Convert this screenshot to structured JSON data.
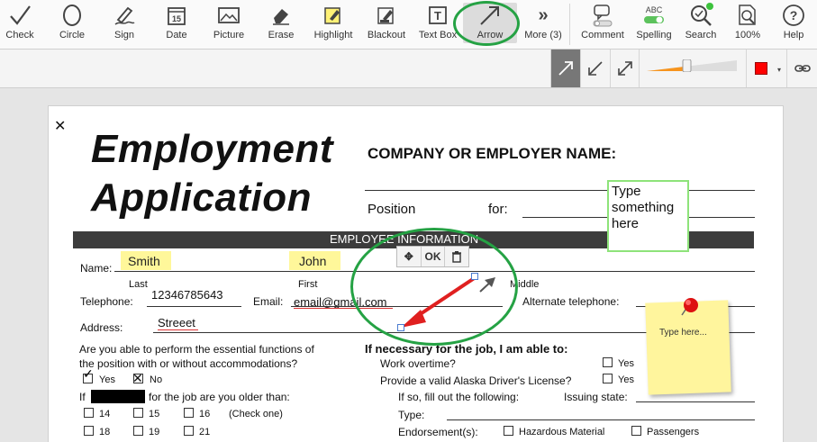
{
  "toolbar": {
    "tools": [
      {
        "label": "Check",
        "icon": "check-icon"
      },
      {
        "label": "Circle",
        "icon": "circle-icon"
      },
      {
        "label": "Sign",
        "icon": "sign-icon"
      },
      {
        "label": "Date",
        "icon": "date-icon"
      },
      {
        "label": "Picture",
        "icon": "picture-icon"
      },
      {
        "label": "Erase",
        "icon": "erase-icon"
      },
      {
        "label": "Highlight",
        "icon": "highlight-icon"
      },
      {
        "label": "Blackout",
        "icon": "blackout-icon"
      },
      {
        "label": "Text Box",
        "icon": "textbox-icon"
      },
      {
        "label": "Arrow",
        "icon": "arrow-icon",
        "active": true
      },
      {
        "label": "More (3)",
        "icon": "more-icon"
      },
      {
        "label": "Comment",
        "icon": "comment-icon"
      },
      {
        "label": "Spelling",
        "icon": "spelling-icon",
        "sub": "ABC"
      },
      {
        "label": "Search",
        "icon": "search-icon"
      },
      {
        "label": "100%",
        "icon": "zoom-icon"
      },
      {
        "label": "Help",
        "icon": "help-icon"
      }
    ]
  },
  "subbar": {
    "arrow_styles": [
      "arrow-end",
      "arrow-start",
      "arrow-both"
    ],
    "stroke_color": "#ff0000",
    "slider_value": 0.45
  },
  "document": {
    "close_glyph": "✕",
    "title_line1": "Employment",
    "title_line2": "Application",
    "company_label": "COMPANY OR EMPLOYER NAME:",
    "position_label": "Position",
    "for_label": "for:",
    "textbox_text": "Type something here",
    "section_title": "EMPLOYEE INFORMATION",
    "name_label": "Name:",
    "last_value": "Smith",
    "first_value": "John",
    "last_label": "Last",
    "first_label": "First",
    "middle_label": "Middle",
    "telephone_label": "Telephone:",
    "telephone_value": "12346785643",
    "email_label": "Email:",
    "email_value": "email@gmail.com",
    "alt_phone_label": "Alternate telephone:",
    "address_label": "Address:",
    "address_value": "Streeet",
    "essential_q1": "Are you able to perform the essential functions of",
    "essential_q2": "the position with or without accommodations?",
    "yes": "Yes",
    "no": "No",
    "if_label": "If",
    "older_label": "for the job are you older than:",
    "ages": [
      "14",
      "15",
      "16",
      "18",
      "19",
      "21"
    ],
    "check_one": "(Check one)",
    "necessary_label": "If necessary for the job, I am able to:",
    "overtime_label": "Work overtime?",
    "license_label": "Provide a valid Alaska Driver's License?",
    "fill_label": "If so, fill out the following:",
    "issuing_label": "Issuing state:",
    "type_label": "Type:",
    "endorsement_label": "Endorsement(s):",
    "hazmat_label": "Hazardous Material",
    "passengers_label": "Passengers",
    "sticky_text": "Type here...",
    "mini_ok": "OK"
  }
}
